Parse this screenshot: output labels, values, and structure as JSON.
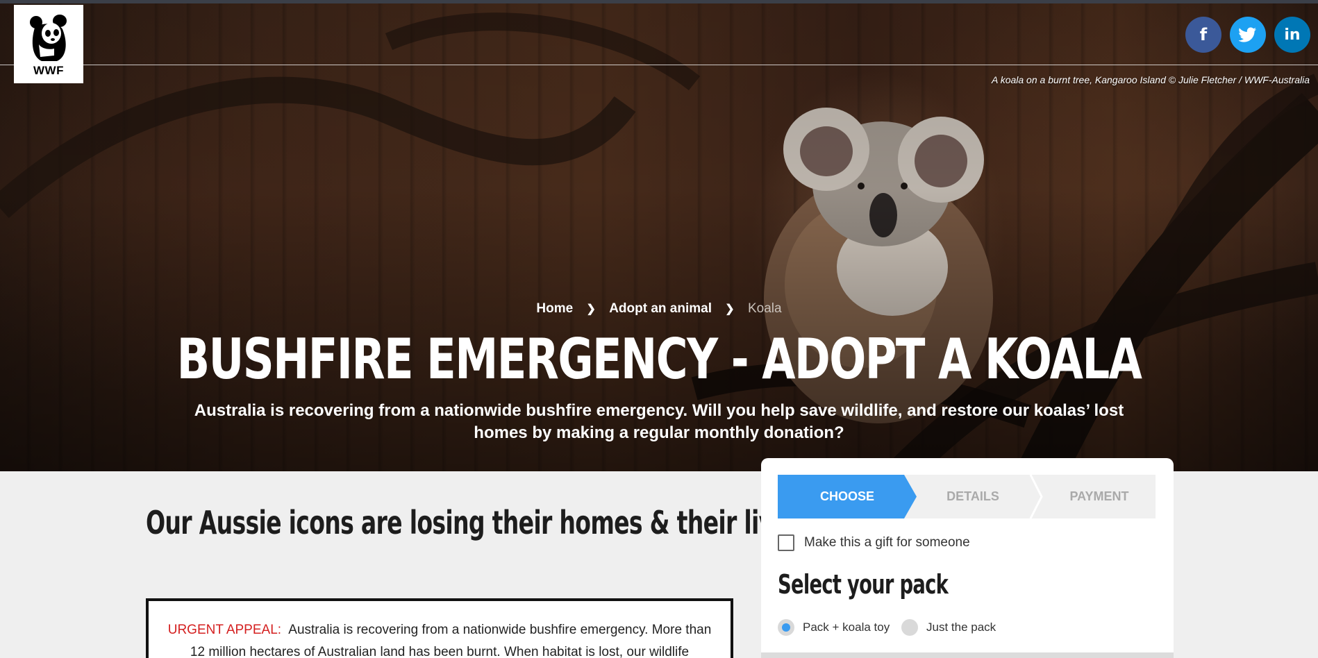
{
  "logo": {
    "wordmark": "WWF"
  },
  "social": [
    {
      "name": "facebook",
      "glyph": "f"
    },
    {
      "name": "twitter",
      "glyph": "t"
    },
    {
      "name": "linkedin",
      "glyph": "in"
    }
  ],
  "hero": {
    "photo_credit": "A koala on a burnt tree, Kangaroo Island © Julie Fletcher / WWF-Australia",
    "breadcrumb": [
      "Home",
      "Adopt an animal",
      "Koala"
    ],
    "title": "BUSHFIRE EMERGENCY - ADOPT A KOALA",
    "subtitle": "Australia is recovering from a nationwide bushfire emergency. Will you help save wildlife, and restore our koalas’ lost homes by making a regular monthly donation?"
  },
  "content": {
    "heading": "Our Aussie icons are losing their homes & their lives",
    "appeal_label": "URGENT APPEAL:",
    "appeal_text": "Australia is recovering from a nationwide bushfire emergency. More than 12 million hectares of Australian land has been burnt. When habitat is lost, our wildlife"
  },
  "form": {
    "steps": [
      "CHOOSE",
      "DETAILS",
      "PAYMENT"
    ],
    "active_step": "CHOOSE",
    "gift_label": "Make this a gift for someone",
    "gift_checked": false,
    "select_title": "Select your pack",
    "pack_options": [
      {
        "label": "Pack + koala toy",
        "selected": true
      },
      {
        "label": "Just the pack",
        "selected": false
      }
    ]
  },
  "colors": {
    "accent": "#3a9bf0",
    "urgent": "#d41f1f",
    "facebook": "#3b5999",
    "twitter": "#1da1f2",
    "linkedin": "#0077b5"
  }
}
